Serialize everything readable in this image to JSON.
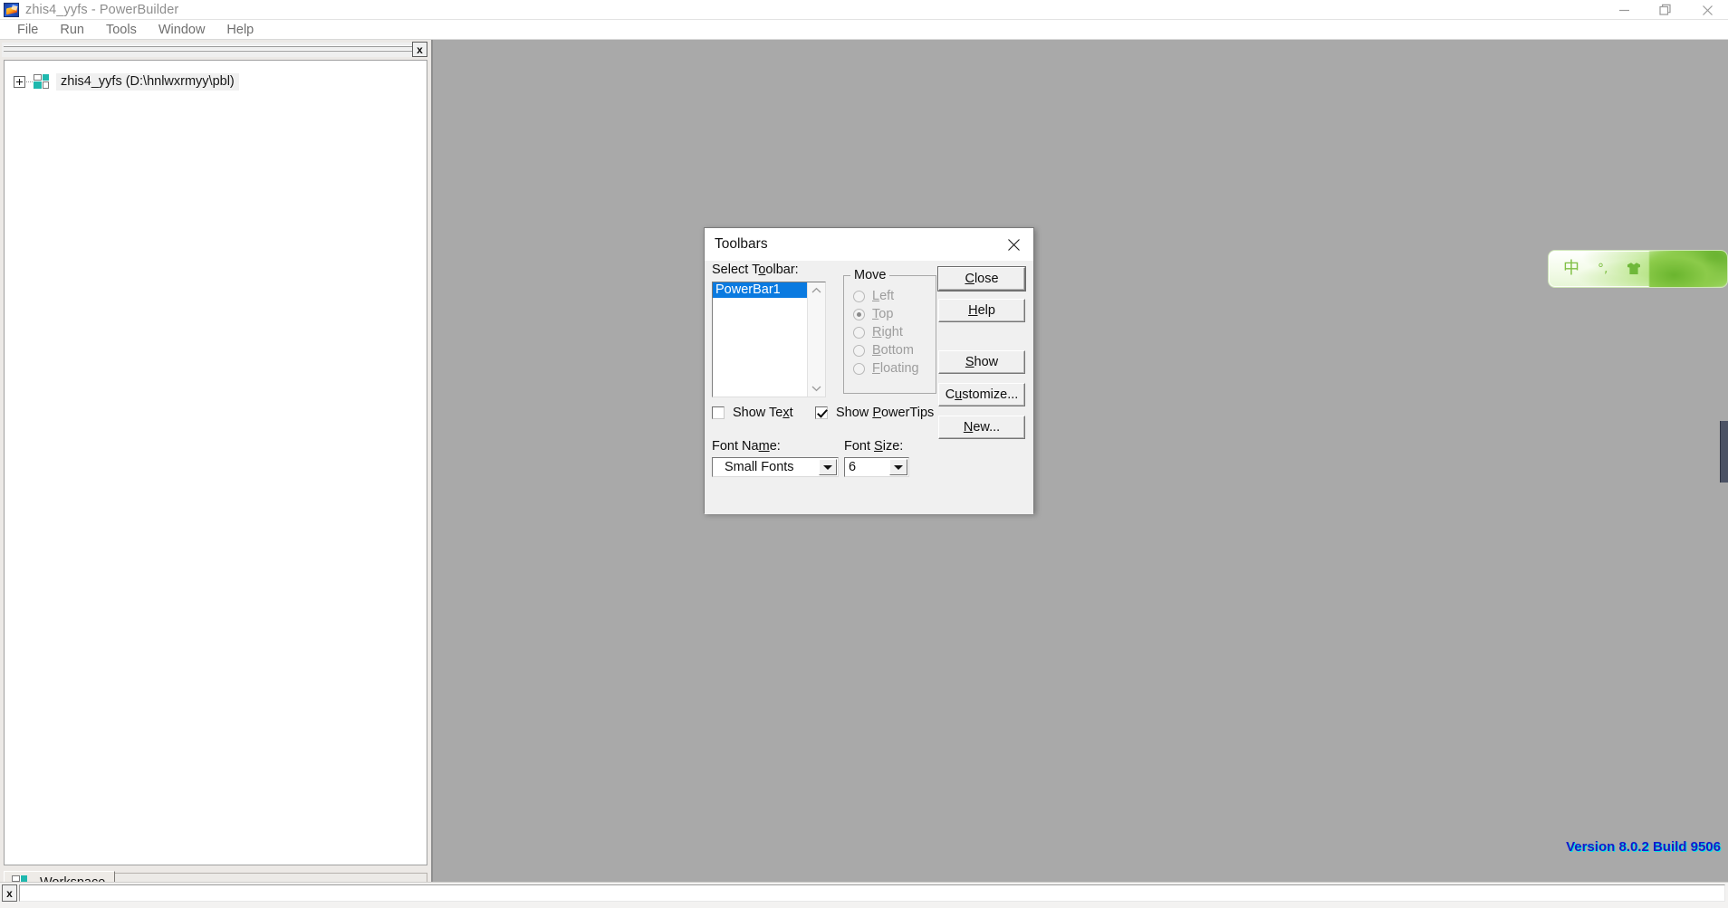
{
  "window": {
    "title": "zhis4_yyfs - PowerBuilder",
    "app_icon": "powerbuilder-icon",
    "controls": {
      "minimize": "minimize-icon",
      "restore": "restore-icon",
      "close": "close-icon"
    }
  },
  "menubar": {
    "items": [
      {
        "label": "File"
      },
      {
        "label": "Run"
      },
      {
        "label": "Tools"
      },
      {
        "label": "Window"
      },
      {
        "label": "Help"
      }
    ]
  },
  "left_panel": {
    "close_label": "x",
    "tree": {
      "items": [
        {
          "label": "zhis4_yyfs (D:\\hnlwxrmyy\\pbl)",
          "icon": "workspace-icon",
          "expander": "plus"
        }
      ]
    },
    "tabs": [
      {
        "label": "Workspace",
        "icon": "workspace-icon",
        "active": true
      }
    ]
  },
  "status": {
    "output_close_label": "x",
    "version_text": "Version 8.0.2 Build 9506",
    "version_color": "#1818c8"
  },
  "ime_bar": {
    "mode": "中",
    "punctuation": "°,",
    "toolbox": "shirt-icon"
  },
  "dialog": {
    "title": "Toolbars",
    "close_icon": "close-icon",
    "select_toolbar_label": "Select T<u>o</u>olbar:",
    "list": {
      "items": [
        {
          "label": "PowerBar1",
          "selected": true
        }
      ],
      "scroll_up": "chevron-up-icon",
      "scroll_down": "chevron-down-icon"
    },
    "move_group": {
      "title": "Move",
      "options": [
        {
          "label": "<u>L</u>eft",
          "selected": false,
          "disabled": true
        },
        {
          "label": "<u>T</u>op",
          "selected": true,
          "disabled": true
        },
        {
          "label": "<u>R</u>ight",
          "selected": false,
          "disabled": true
        },
        {
          "label": "<u>B</u>ottom",
          "selected": false,
          "disabled": true
        },
        {
          "label": "<u>F</u>loating",
          "selected": false,
          "disabled": true
        }
      ]
    },
    "checkboxes": [
      {
        "label": "Show Te<u>x</u>t",
        "checked": false
      },
      {
        "label": "Show <u>P</u>owerTips",
        "checked": true
      }
    ],
    "font_name": {
      "label": "Font Na<u>m</u>e:",
      "value": "Small Fonts"
    },
    "font_size": {
      "label": "Font <u>S</u>ize:",
      "value": "6"
    },
    "buttons": [
      {
        "label": "<u>C</u>lose",
        "default": true
      },
      {
        "label": "<u>H</u>elp",
        "default": false
      },
      {
        "label": "<u>S</u>how",
        "default": false
      },
      {
        "label": "C<u>u</u>stomize...",
        "default": false
      },
      {
        "label": "<u>N</u>ew...",
        "default": false
      }
    ]
  }
}
